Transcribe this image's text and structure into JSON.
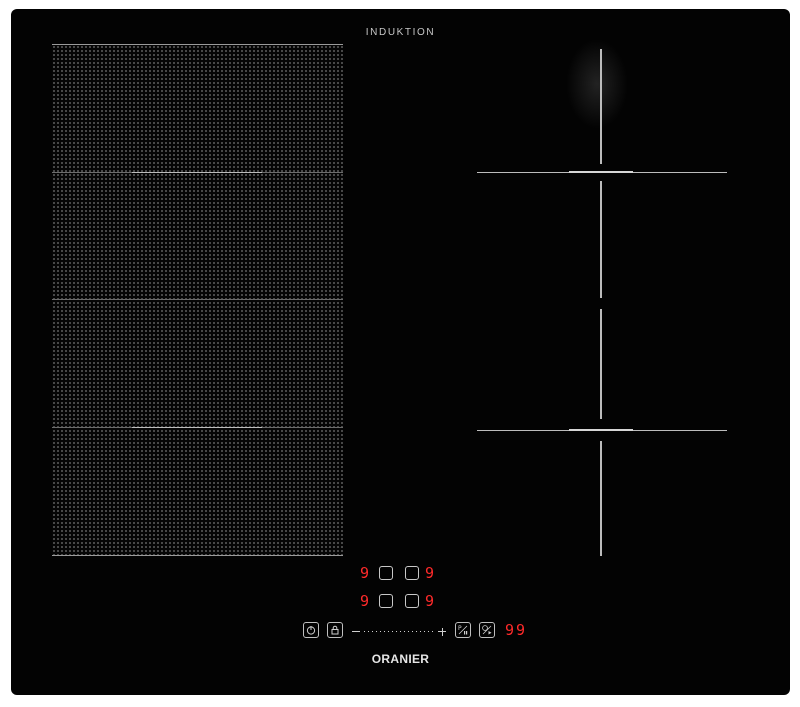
{
  "header": {
    "label": "INDUKTION"
  },
  "brand": {
    "name": "ORANIER"
  },
  "zones": {
    "front_left_level": "9",
    "front_right_level": "9",
    "rear_left_level": "9",
    "rear_right_level": "9"
  },
  "timer": {
    "display": "99"
  },
  "controls": {
    "power_icon": "power-icon",
    "lock_icon": "lock-icon",
    "pause_icon": "pause-icon",
    "timer_icon": "timer-icon"
  },
  "colors": {
    "panel": "#030303",
    "display_red": "#ff2a2a",
    "marking": "#bcbcbc"
  }
}
